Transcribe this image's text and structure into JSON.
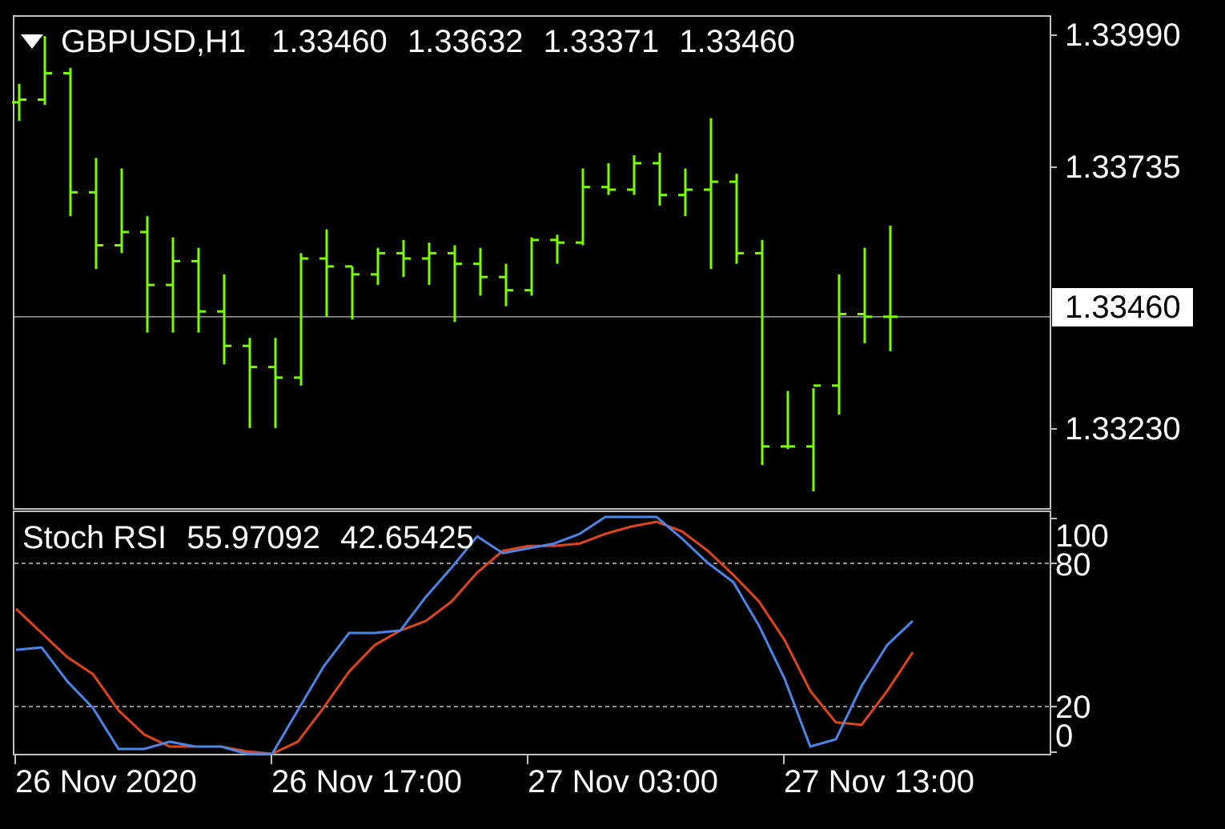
{
  "header": {
    "symbol": "GBPUSD,H1",
    "open": "1.33460",
    "high": "1.33632",
    "low": "1.33371",
    "close": "1.33460"
  },
  "indicator": {
    "name": "Stoch RSI",
    "value1": "55.97092",
    "value2": "42.65425"
  },
  "price_axis": [
    "1.33990",
    "1.33735",
    "1.33230"
  ],
  "current_price": "1.33460",
  "osc_axis": [
    "100",
    "80",
    "20",
    "0"
  ],
  "time_axis": [
    "26 Nov 2020",
    "26 Nov 17:00",
    "27 Nov 03:00",
    "27 Nov 13:00"
  ],
  "colors": {
    "background": "#000000",
    "bars": "#7CFC00",
    "stoch_k": "#4A86E8",
    "stoch_d": "#E0441A",
    "grid": "#C0C0C0"
  },
  "chart_data": [
    {
      "type": "ohlc",
      "title": "GBPUSD,H1",
      "y_ticks": [
        1.3399,
        1.33735,
        1.3323
      ],
      "ylim": [
        1.331,
        1.34025
      ],
      "current_price_line": 1.3346,
      "bars": [
        {
          "o": 1.33865,
          "h": 1.339,
          "l": 1.3383,
          "c": 1.3387
        },
        {
          "o": 1.3387,
          "h": 1.3399,
          "l": 1.3386,
          "c": 1.3392
        },
        {
          "o": 1.3392,
          "h": 1.3393,
          "l": 1.3365,
          "c": 1.33695
        },
        {
          "o": 1.33695,
          "h": 1.3376,
          "l": 1.3355,
          "c": 1.33595
        },
        {
          "o": 1.33595,
          "h": 1.3374,
          "l": 1.3358,
          "c": 1.3362
        },
        {
          "o": 1.3362,
          "h": 1.3365,
          "l": 1.3343,
          "c": 1.3352
        },
        {
          "o": 1.3352,
          "h": 1.3361,
          "l": 1.3343,
          "c": 1.33565
        },
        {
          "o": 1.33565,
          "h": 1.3359,
          "l": 1.3343,
          "c": 1.3347
        },
        {
          "o": 1.3347,
          "h": 1.3354,
          "l": 1.3337,
          "c": 1.33405
        },
        {
          "o": 1.33405,
          "h": 1.3342,
          "l": 1.3325,
          "c": 1.33365
        },
        {
          "o": 1.33365,
          "h": 1.3342,
          "l": 1.3325,
          "c": 1.33345
        },
        {
          "o": 1.33345,
          "h": 1.3358,
          "l": 1.3333,
          "c": 1.3357
        },
        {
          "o": 1.3357,
          "h": 1.33625,
          "l": 1.3346,
          "c": 1.33555
        },
        {
          "o": 1.33555,
          "h": 1.33555,
          "l": 1.33455,
          "c": 1.3354
        },
        {
          "o": 1.3354,
          "h": 1.3359,
          "l": 1.3352,
          "c": 1.3358
        },
        {
          "o": 1.3358,
          "h": 1.33605,
          "l": 1.33535,
          "c": 1.3357
        },
        {
          "o": 1.3357,
          "h": 1.336,
          "l": 1.3352,
          "c": 1.3358
        },
        {
          "o": 1.3358,
          "h": 1.33595,
          "l": 1.3345,
          "c": 1.3356
        },
        {
          "o": 1.3356,
          "h": 1.3359,
          "l": 1.335,
          "c": 1.33535
        },
        {
          "o": 1.33535,
          "h": 1.3356,
          "l": 1.3348,
          "c": 1.3351
        },
        {
          "o": 1.3351,
          "h": 1.3361,
          "l": 1.335,
          "c": 1.33605
        },
        {
          "o": 1.33605,
          "h": 1.33615,
          "l": 1.3356,
          "c": 1.336
        },
        {
          "o": 1.336,
          "h": 1.3374,
          "l": 1.33595,
          "c": 1.33705
        },
        {
          "o": 1.33705,
          "h": 1.3375,
          "l": 1.3369,
          "c": 1.337
        },
        {
          "o": 1.337,
          "h": 1.33765,
          "l": 1.3369,
          "c": 1.3375
        },
        {
          "o": 1.3375,
          "h": 1.3377,
          "l": 1.3367,
          "c": 1.3369
        },
        {
          "o": 1.3369,
          "h": 1.3374,
          "l": 1.3365,
          "c": 1.337
        },
        {
          "o": 1.337,
          "h": 1.33835,
          "l": 1.3355,
          "c": 1.33715
        },
        {
          "o": 1.33715,
          "h": 1.3373,
          "l": 1.3356,
          "c": 1.3358
        },
        {
          "o": 1.3358,
          "h": 1.33605,
          "l": 1.3318,
          "c": 1.33215
        },
        {
          "o": 1.33215,
          "h": 1.3332,
          "l": 1.3321,
          "c": 1.33215
        },
        {
          "o": 1.33215,
          "h": 1.33325,
          "l": 1.3313,
          "c": 1.3333
        },
        {
          "o": 1.3333,
          "h": 1.3354,
          "l": 1.33275,
          "c": 1.33465
        },
        {
          "o": 1.33465,
          "h": 1.3359,
          "l": 1.3341,
          "c": 1.3346
        },
        {
          "o": 1.3346,
          "h": 1.33632,
          "l": 1.33395,
          "c": 1.3346
        }
      ]
    },
    {
      "type": "line",
      "title": "Stoch RSI 55.97092 42.65425",
      "ylim": [
        0,
        100
      ],
      "y_ticks": [
        100,
        80,
        20,
        0
      ],
      "levels": [
        80,
        20
      ],
      "series": [
        {
          "values": [
            43,
            44,
            30,
            19,
            2,
            2,
            5,
            3,
            3,
            0,
            0,
            18,
            36,
            50,
            50,
            51,
            65,
            77,
            90,
            83,
            85,
            87,
            91,
            98,
            98,
            98,
            89,
            79,
            71,
            53,
            31,
            3,
            6,
            28,
            45,
            55
          ]
        },
        {
          "values": [
            60,
            50,
            40,
            33,
            18,
            8,
            3,
            3,
            3,
            1,
            0,
            5,
            19,
            34,
            45,
            51,
            55,
            63,
            75,
            84,
            86,
            86,
            87,
            91,
            94,
            96,
            92,
            84,
            74,
            63,
            47,
            26,
            13,
            12,
            26,
            42
          ]
        }
      ]
    }
  ]
}
